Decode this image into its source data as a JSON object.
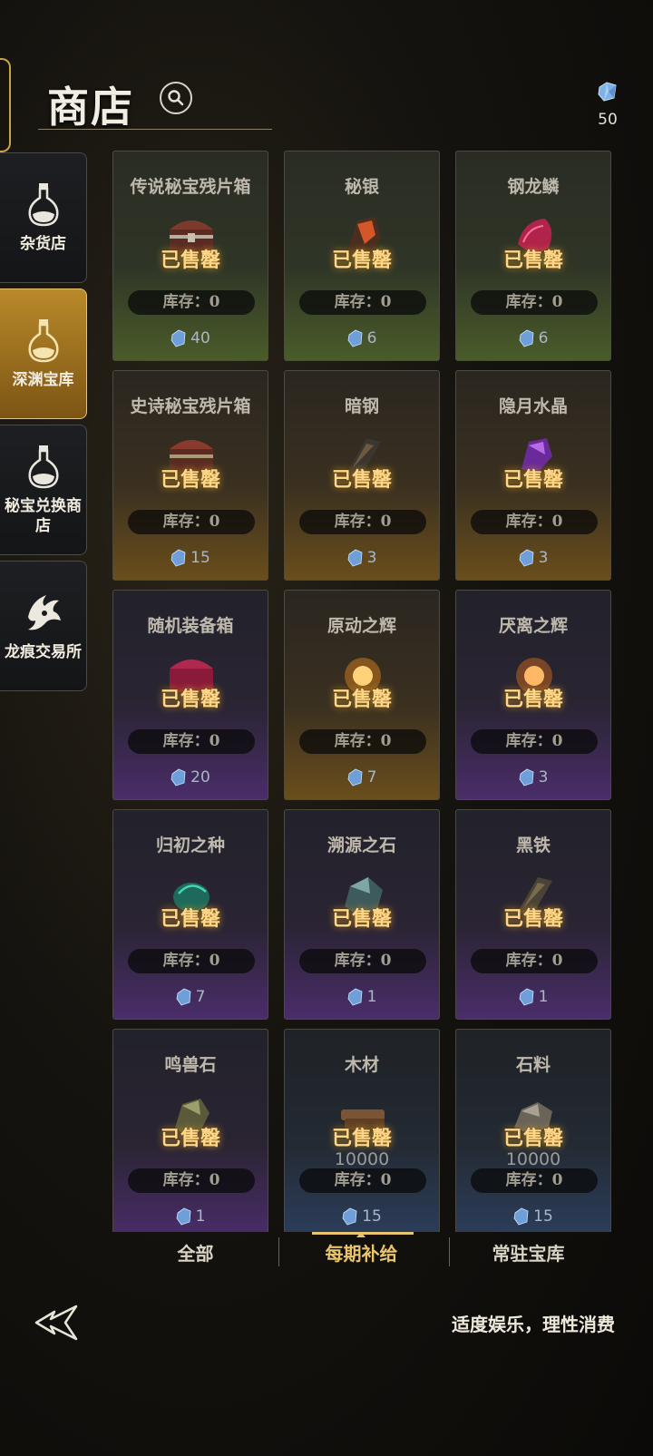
{
  "header": {
    "title": "商店",
    "currency_amount": "50"
  },
  "sidebar": {
    "items": [
      {
        "label": "杂货店",
        "icon": "potion-flask-icon",
        "active": false
      },
      {
        "label": "深渊宝库",
        "icon": "potion-flask-icon",
        "active": true
      },
      {
        "label": "秘宝兑换商店",
        "icon": "potion-flask-icon",
        "active": false
      },
      {
        "label": "龙痕交易所",
        "icon": "dragon-emblem-icon",
        "active": false
      }
    ]
  },
  "shop": {
    "sold_label": "已售罄",
    "stock_prefix": "库存：",
    "items": [
      {
        "name": "传说秘宝残片箱",
        "stock": "0",
        "price": "40",
        "rarity": "green",
        "icon": "treasure-chest-icon"
      },
      {
        "name": "秘银",
        "stock": "0",
        "price": "6",
        "rarity": "green",
        "icon": "mithril-ore-icon"
      },
      {
        "name": "钢龙鳞",
        "stock": "0",
        "price": "6",
        "rarity": "green",
        "icon": "dragon-scale-icon"
      },
      {
        "name": "史诗秘宝残片箱",
        "stock": "0",
        "price": "15",
        "rarity": "gold",
        "icon": "treasure-chest-icon"
      },
      {
        "name": "暗钢",
        "stock": "0",
        "price": "3",
        "rarity": "gold",
        "icon": "dark-steel-icon"
      },
      {
        "name": "隐月水晶",
        "stock": "0",
        "price": "3",
        "rarity": "gold",
        "icon": "purple-crystal-icon"
      },
      {
        "name": "随机装备箱",
        "stock": "0",
        "price": "20",
        "rarity": "purple",
        "icon": "equipment-chest-icon"
      },
      {
        "name": "原动之辉",
        "stock": "0",
        "price": "7",
        "rarity": "gold",
        "icon": "glow-orb-icon"
      },
      {
        "name": "厌离之辉",
        "stock": "0",
        "price": "3",
        "rarity": "purple",
        "icon": "glow-orb-icon"
      },
      {
        "name": "归初之种",
        "stock": "0",
        "price": "7",
        "rarity": "purple",
        "icon": "seed-icon"
      },
      {
        "name": "溯源之石",
        "stock": "0",
        "price": "1",
        "rarity": "purple",
        "icon": "origin-stone-icon"
      },
      {
        "name": "黑铁",
        "stock": "0",
        "price": "1",
        "rarity": "purple",
        "icon": "black-iron-icon"
      },
      {
        "name": "鸣兽石",
        "stock": "0",
        "price": "1",
        "rarity": "purple",
        "icon": "beast-stone-icon"
      },
      {
        "name": "木材",
        "stock": "0",
        "price": "15",
        "rarity": "blue",
        "icon": "wood-icon",
        "quantity": "10000"
      },
      {
        "name": "石料",
        "stock": "0",
        "price": "15",
        "rarity": "blue",
        "icon": "stone-icon",
        "quantity": "10000"
      }
    ]
  },
  "tabs": [
    {
      "label": "全部",
      "active": false
    },
    {
      "label": "每期补给",
      "active": true
    },
    {
      "label": "常驻宝库",
      "active": false
    }
  ],
  "footer": {
    "notice": "适度娱乐，理性消费"
  },
  "colors": {
    "accent_gold": "#e8c46a",
    "sold_text": "#ffd78a"
  }
}
